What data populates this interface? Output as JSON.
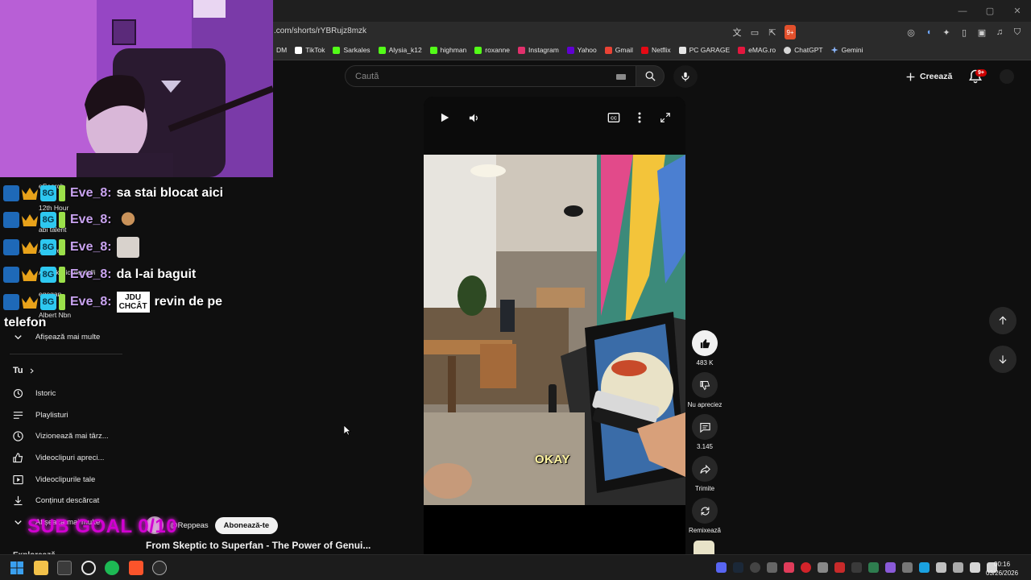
{
  "browser": {
    "url": ".com/shorts/rYBRujz8mzk",
    "brave_badge": "9+",
    "bookmarks": [
      {
        "label": "DM",
        "color": "#1f1f1f"
      },
      {
        "label": "TikTok",
        "color": "#ffffff"
      },
      {
        "label": "Sarkales",
        "color": "#53fc18"
      },
      {
        "label": "Alysia_k12",
        "color": "#53fc18"
      },
      {
        "label": "highman",
        "color": "#53fc18"
      },
      {
        "label": "roxanne",
        "color": "#53fc18"
      },
      {
        "label": "Instagram",
        "color": "#e1306c"
      },
      {
        "label": "Yahoo",
        "color": "#6001d2"
      },
      {
        "label": "Gmail",
        "color": "#ea4335"
      },
      {
        "label": "Netflix",
        "color": "#e50914"
      },
      {
        "label": "PC GARAGE",
        "color": "#e6e6e6"
      },
      {
        "label": "eMAG.ro",
        "color": "#e3173e"
      },
      {
        "label": "ChatGPT",
        "color": "#d6d6d6"
      },
      {
        "label": "Gemini",
        "color": "#8ab4f8"
      }
    ]
  },
  "header": {
    "search_placeholder": "Caută",
    "create_label": "Creează",
    "notifications_badge": "9+"
  },
  "sidebar": {
    "show_more_top": "Afișează mai multe",
    "you_label": "Tu",
    "items": [
      {
        "label": "Istoric",
        "icon": "history-icon"
      },
      {
        "label": "Playlisturi",
        "icon": "playlist-icon"
      },
      {
        "label": "Vizionează mai târz...",
        "icon": "clock-icon"
      },
      {
        "label": "Videoclipuri apreci...",
        "icon": "thumbs-up-icon"
      },
      {
        "label": "Videoclipurile tale",
        "icon": "play-square-icon"
      },
      {
        "label": "Conținut descărcat",
        "icon": "download-icon"
      }
    ],
    "show_more_bottom": "Afișează mai multe",
    "explore_label": "Explorează",
    "ghost_subscriptions": [
      "eSearch",
      "12th Hour",
      "abi talent",
      "AlRave",
      "Akunikkiliciliterdelli",
      "egegan",
      "Albert Nbn"
    ]
  },
  "short": {
    "caption_overlay": "OKAY",
    "likes": "483 K",
    "dislike_label": "Nu apreciez",
    "comments": "3.145",
    "share_label": "Trimite",
    "remix_label": "Remixează",
    "channel": "@Reppeas",
    "subscribe_label": "Abonează-te",
    "title": "From Skeptic to Superfan - The Power of Genui..."
  },
  "stream_overlay": {
    "chat": [
      {
        "user": "Eve_8:",
        "message": "sa stai blocat aici"
      },
      {
        "user": "Eve_8:",
        "message": "",
        "emote": "monkey-emote"
      },
      {
        "user": "Eve_8:",
        "message": "",
        "emote": "face-emote"
      },
      {
        "user": "Eve_8:",
        "message": "da l-ai baguit"
      },
      {
        "user": "Eve_8:",
        "message": "revin de pe",
        "emote_text_1": "JDU",
        "emote_text_2": "CHCÂT"
      }
    ],
    "chat_wrap": "telefon",
    "badge_number": "8G",
    "sub_goal": "SUB GOAL 0/10"
  },
  "taskbar": {
    "time": "00:16",
    "date": "03/26/2026"
  }
}
